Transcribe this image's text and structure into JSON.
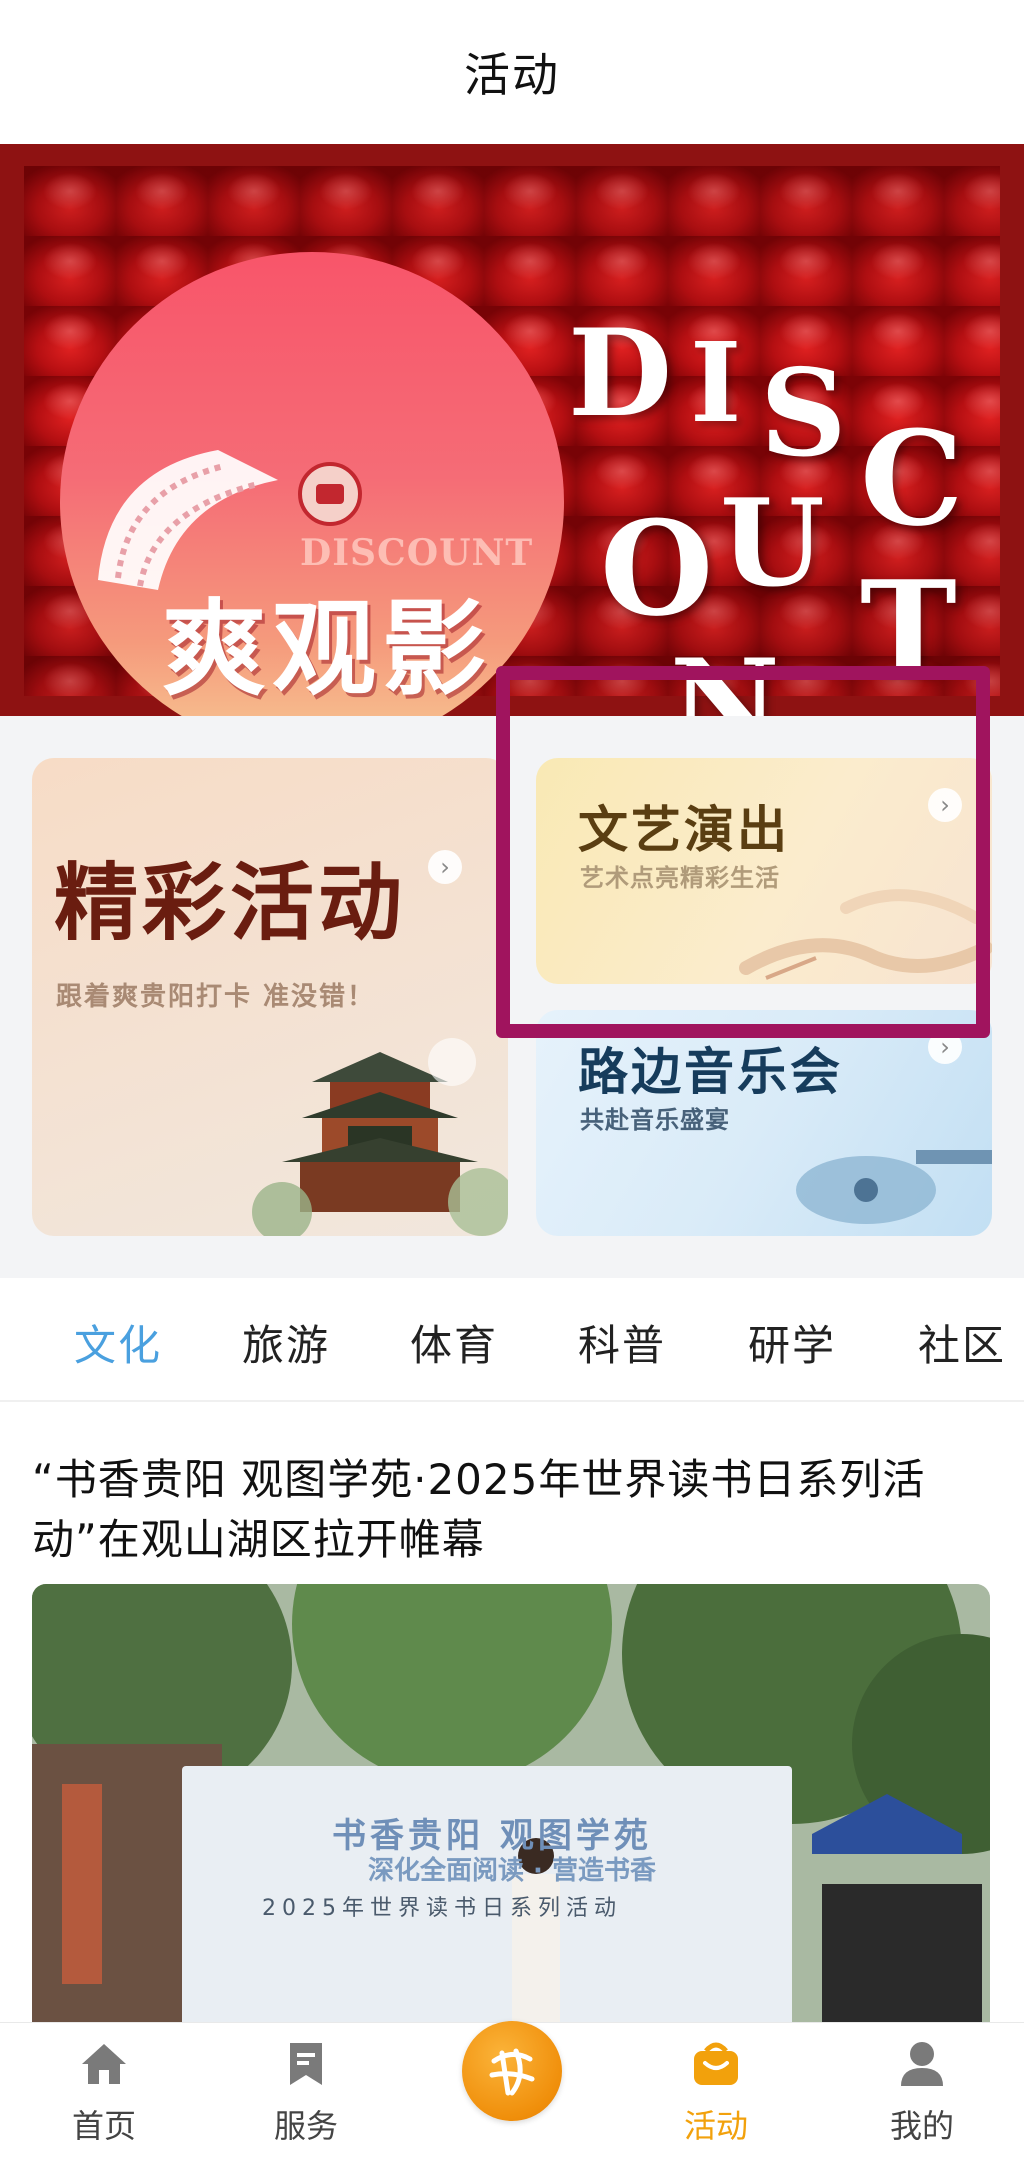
{
  "header": {
    "title": "活动"
  },
  "banner": {
    "title": "爽观影",
    "subtitle_en": "DISCOUNT",
    "big_letters": [
      "D",
      "I",
      "S",
      "C",
      "O",
      "U",
      "N",
      "T"
    ]
  },
  "cards": {
    "featured": {
      "title": "精彩活动",
      "subtitle": "跟着爽贵阳打卡 准没错！"
    },
    "performance": {
      "title": "文艺演出",
      "subtitle": "艺术点亮精彩生活"
    },
    "music": {
      "title": "路边音乐会",
      "subtitle": "共赴音乐盛宴"
    }
  },
  "tabs": [
    {
      "label": "文化",
      "active": true
    },
    {
      "label": "旅游",
      "active": false
    },
    {
      "label": "体育",
      "active": false
    },
    {
      "label": "科普",
      "active": false
    },
    {
      "label": "研学",
      "active": false
    },
    {
      "label": "社区",
      "active": false
    }
  ],
  "article": {
    "title": "“书香贵阳 观图学苑·2025年世界读书日系列活动”在观山湖区拉开帷幕",
    "photo": {
      "board_line1": "书香贵阳 观图学苑",
      "board_line2": "深化全面阅读 · 营造书香",
      "board_line3": "2025年世界读书日系列活动"
    }
  },
  "bottom_nav": [
    {
      "label": "首页",
      "icon": "home-icon",
      "active": false
    },
    {
      "label": "服务",
      "icon": "bookmark-icon",
      "active": false
    },
    {
      "label": "",
      "icon": "brand-logo-icon",
      "active": false
    },
    {
      "label": "活动",
      "icon": "bag-icon",
      "active": true
    },
    {
      "label": "我的",
      "icon": "user-icon",
      "active": false
    }
  ],
  "colors": {
    "active_tab": "#4aa0df",
    "active_nav": "#f2a10c",
    "highlight_box": "#a0145e",
    "banner_frame": "#8e1212"
  }
}
